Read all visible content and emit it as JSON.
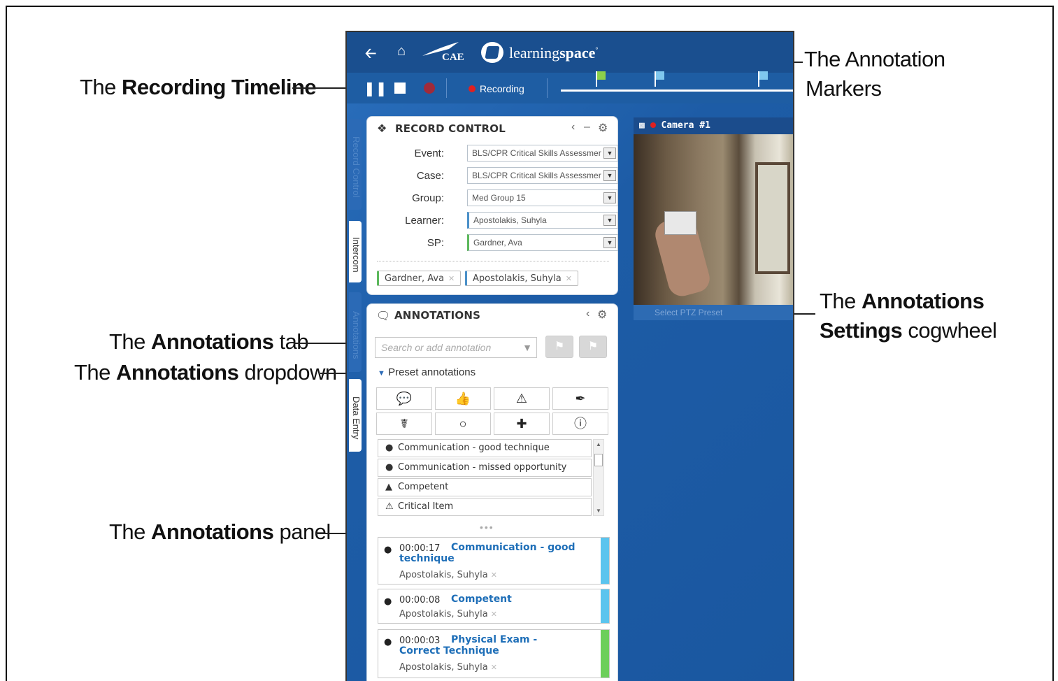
{
  "callouts": {
    "recording_timeline": {
      "prefix": "The ",
      "bold": "Recording Timeline",
      "suffix": ""
    },
    "annotation_markers_line1": "The Annotation",
    "annotation_markers_line2": "Markers",
    "annotations_tab": {
      "prefix": "The ",
      "bold": "Annotations",
      "suffix": " tab"
    },
    "annotations_dropdown": {
      "prefix": "The ",
      "bold": "Annotations",
      "suffix": " dropdown"
    },
    "annotations_panel": {
      "prefix": "The ",
      "bold": "Annotations",
      "suffix": " panel"
    },
    "settings_line1": {
      "prefix": "The ",
      "bold": "Annotations"
    },
    "settings_line2": {
      "bold": "Settings",
      "suffix": " cogwheel"
    }
  },
  "header": {
    "brand_cae": "CAE",
    "brand_learning": "learning",
    "brand_space": "space",
    "brand_reg": "°",
    "recording_label": "Recording"
  },
  "side_tabs": [
    "Record Control",
    "Intercom",
    "Annotations",
    "Data Entry"
  ],
  "record_control": {
    "title": "RECORD CONTROL",
    "fields": [
      {
        "label": "Event:",
        "value": "BLS/CPR Critical Skills Assessmer"
      },
      {
        "label": "Case:",
        "value": "BLS/CPR Critical Skills Assessmer"
      },
      {
        "label": "Group:",
        "value": "Med Group 15"
      },
      {
        "label": "Learner:",
        "value": "Apostolakis, Suhyla"
      },
      {
        "label": "SP:",
        "value": "Gardner, Ava"
      }
    ],
    "tags": [
      "Gardner, Ava",
      "Apostolakis, Suhyla"
    ]
  },
  "camera": {
    "title": "Camera #1",
    "footer": "Select PTZ Preset"
  },
  "annotations": {
    "title": "ANNOTATIONS",
    "search_placeholder": "Search or add annotation",
    "preset_toggle": "Preset annotations",
    "preset_items": [
      {
        "icon": "comment-icon",
        "label": "Communication - good technique"
      },
      {
        "icon": "comment-icon",
        "label": "Communication - missed opportunity"
      },
      {
        "icon": "thumbs-up-icon",
        "label": "Competent"
      },
      {
        "icon": "warning-icon",
        "label": "Critical Item"
      }
    ],
    "entries": [
      {
        "time": "00:00:17",
        "title": "Communication - good technique",
        "who": "Apostolakis, Suhyla",
        "color": "#5bc4ee"
      },
      {
        "time": "00:00:08",
        "title": "Competent",
        "who": "Apostolakis, Suhyla",
        "color": "#5bc4ee"
      },
      {
        "time": "00:00:03",
        "title": "Physical Exam - Correct Technique",
        "who": "Apostolakis, Suhyla",
        "color": "#6ccf5a"
      }
    ]
  }
}
